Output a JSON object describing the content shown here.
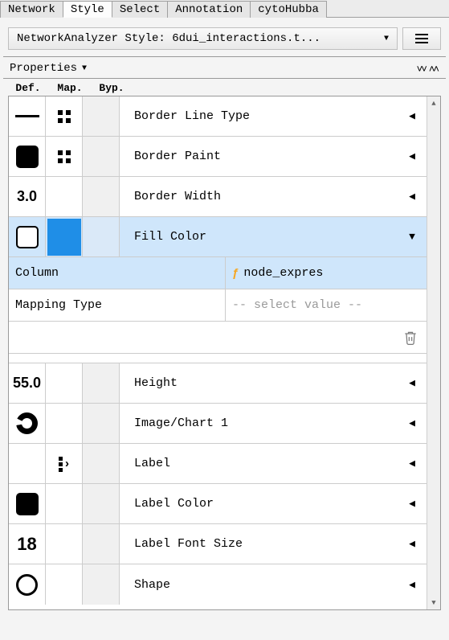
{
  "tabs": [
    "Network",
    "Style",
    "Select",
    "Annotation",
    "cytoHubba"
  ],
  "active_tab": 1,
  "style_selector_label": "NetworkAnalyzer Style: 6dui_interactions.t...",
  "properties_title": "Properties",
  "col_headers": {
    "def": "Def.",
    "map": "Map.",
    "byp": "Byp."
  },
  "rows": [
    {
      "id": "border-line-type",
      "label": "Border Line Type",
      "def_text": "",
      "expanded": false,
      "selected": false
    },
    {
      "id": "border-paint",
      "label": "Border Paint",
      "def_text": "",
      "expanded": false,
      "selected": false
    },
    {
      "id": "border-width",
      "label": "Border Width",
      "def_text": "3.0",
      "expanded": false,
      "selected": false
    },
    {
      "id": "fill-color",
      "label": "Fill Color",
      "def_text": "",
      "expanded": true,
      "selected": true
    },
    {
      "id": "height",
      "label": "Height",
      "def_text": "55.0",
      "expanded": false,
      "selected": false
    },
    {
      "id": "image-chart-1",
      "label": "Image/Chart 1",
      "def_text": "",
      "expanded": false,
      "selected": false
    },
    {
      "id": "label",
      "label": "Label",
      "def_text": "",
      "expanded": false,
      "selected": false
    },
    {
      "id": "label-color",
      "label": "Label Color",
      "def_text": "",
      "expanded": false,
      "selected": false
    },
    {
      "id": "label-font-size",
      "label": "Label Font Size",
      "def_text": "18",
      "expanded": false,
      "selected": false
    },
    {
      "id": "shape",
      "label": "Shape",
      "def_text": "",
      "expanded": false,
      "selected": false
    }
  ],
  "fill_color_detail": {
    "column_label": "Column",
    "column_value": "node_expres",
    "mapping_type_label": "Mapping Type",
    "mapping_type_placeholder": "-- select value --"
  }
}
